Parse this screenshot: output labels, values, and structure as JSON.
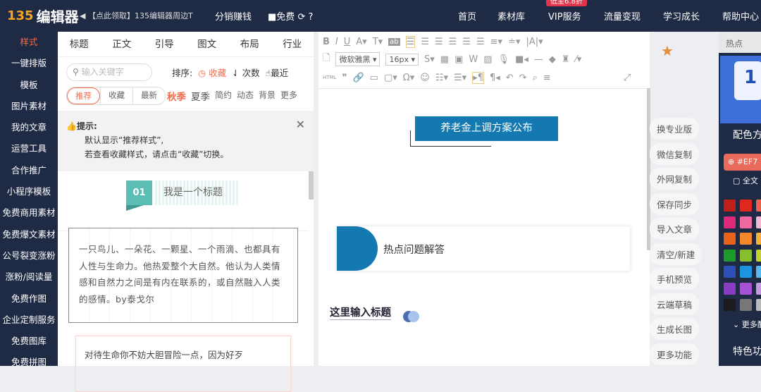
{
  "topbar": {
    "logo_num": "135",
    "logo_text": "编辑器",
    "notice": "【点此领取】135编辑器周边T",
    "distribute": "分销赚钱",
    "free": "免费",
    "nav": [
      "首页",
      "素材库",
      "VIP服务",
      "流量变现",
      "学习成长",
      "帮助中心"
    ],
    "vip_badge": "低至6.8折"
  },
  "sidebar": [
    "样式",
    "一键排版",
    "模板",
    "图片素材",
    "我的文章",
    "运营工具",
    "合作推广",
    "小程序模板",
    "免费商用素材",
    "免费爆文素材",
    "公号裂变涨粉",
    "涨粉/阅读量",
    "免费作图",
    "企业定制服务",
    "免费图库",
    "免费拼图"
  ],
  "panel": {
    "tabs": [
      "标题",
      "正文",
      "引导",
      "图文",
      "布局",
      "行业"
    ],
    "search_placeholder": "输入关键字",
    "sort_label": "排序:",
    "sort": [
      "收藏",
      "次数",
      "最近"
    ],
    "segments": [
      "推荐",
      "收藏",
      "最新"
    ],
    "seasons": [
      "秋季",
      "夏季",
      "简约",
      "动态",
      "背景",
      "更多"
    ],
    "tip_title": "提示:",
    "tip_lines": [
      "默认显示“推荐样式”,",
      "若查看收藏样式，请点击“收藏”切换。"
    ],
    "card1_num": "01",
    "card1_title": "我是一个标题",
    "card2_text": "一只鸟儿、一朵花、一颗星、一个雨滴、也都具有人性与生命力。他热爱整个大自然。他认为人类情感和自然力之间是有内在联系的，或自然融入人类的感情。by泰戈尔",
    "card3_text": "对待生命你不妨大胆冒险一点，因为好歹"
  },
  "editor": {
    "font": "微软雅黑",
    "size": "16px",
    "html": "HTML",
    "title_box": "养老金上调方案公布",
    "section": "热点问题解答",
    "heading": "这里输入标题"
  },
  "side_buttons": [
    "换专业版",
    "微信复制",
    "外网复制",
    "保存同步",
    "导入文章",
    "清空/新建",
    "手机预览",
    "云端草稿",
    "生成长图",
    "更多功能"
  ],
  "right_panel": {
    "tab": "热点",
    "promo_num": "1",
    "scheme": "配色方案",
    "color_value": "#EF7",
    "full_text": "全文",
    "more_colors": "更多配色",
    "features": "特色功能",
    "swatches": [
      [
        "#c0201a",
        "#e0271f",
        "#f06252"
      ],
      [
        "#e0287a",
        "#ee6aa0",
        "#f3b8d2"
      ],
      [
        "#e8621c",
        "#f5892a",
        "#f7b23a"
      ],
      [
        "#1d9a2b",
        "#86be2e",
        "#c5d22e"
      ],
      [
        "#2d4fb8",
        "#1c94e0",
        "#58b8ee"
      ],
      [
        "#8a3cc2",
        "#a652d4",
        "#c59ae0"
      ],
      [
        "#1c1c1c",
        "#777777",
        "#bbbbbb"
      ]
    ]
  }
}
